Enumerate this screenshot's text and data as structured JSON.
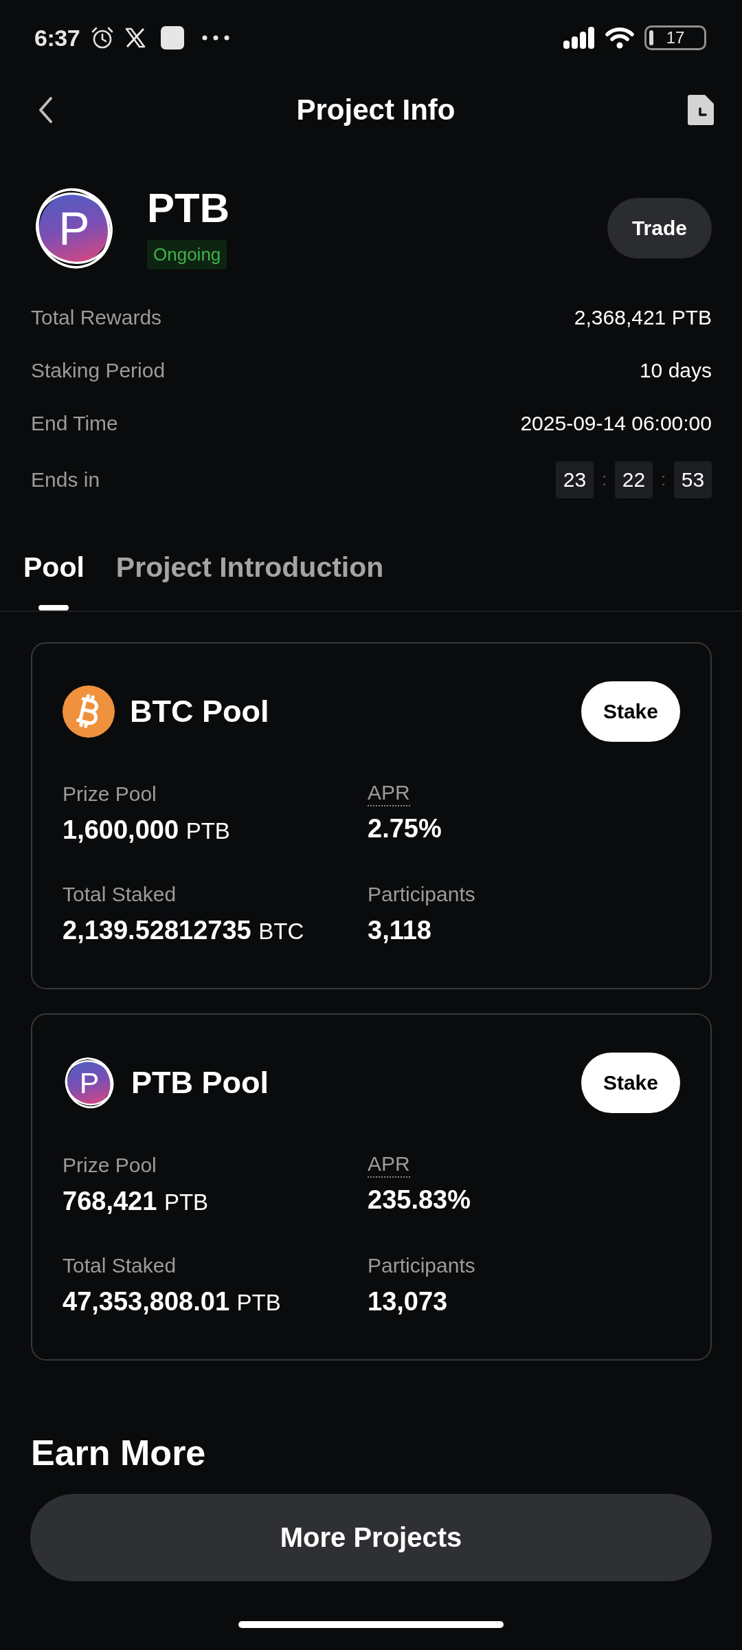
{
  "status_bar": {
    "time": "6:37",
    "battery": "17"
  },
  "header": {
    "title": "Project Info"
  },
  "project": {
    "logo_letter": "P",
    "name": "PTB",
    "status": "Ongoing",
    "trade_button": "Trade"
  },
  "details": [
    {
      "kind": "text",
      "label": "Total Rewards",
      "value": "2,368,421 PTB"
    },
    {
      "kind": "text",
      "label": "Staking Period",
      "value": "10 days"
    },
    {
      "kind": "text",
      "label": "End Time",
      "value": "2025-09-14 06:00:00"
    },
    {
      "kind": "countdown",
      "label": "Ends in",
      "parts": [
        {
          "kind": "digits",
          "text": "23"
        },
        {
          "kind": "separator",
          "text": ":"
        },
        {
          "kind": "digits",
          "text": "22"
        },
        {
          "kind": "separator",
          "text": ":"
        },
        {
          "kind": "digits",
          "text": "53"
        }
      ]
    }
  ],
  "tabs": [
    {
      "label": "Pool",
      "selected": true
    },
    {
      "label": "Project Introduction",
      "selected": false
    }
  ],
  "pools": [
    {
      "kind": "bitcoin",
      "name": "BTC Pool",
      "stake_button": "Stake",
      "stats": [
        {
          "label": "Prize Pool",
          "dotted_underline": false,
          "value": "1,600,000",
          "unit": "PTB"
        },
        {
          "label": "APR",
          "dotted_underline": true,
          "value": "2.75%"
        },
        {
          "label": "Total Staked",
          "dotted_underline": false,
          "value": "2,139.52812735",
          "unit": "BTC"
        },
        {
          "label": "Participants",
          "dotted_underline": false,
          "value": "3,118"
        }
      ]
    },
    {
      "kind": "token",
      "logo_letter": "P",
      "name": "PTB Pool",
      "stake_button": "Stake",
      "stats": [
        {
          "label": "Prize Pool",
          "dotted_underline": false,
          "value": "768,421",
          "unit": "PTB"
        },
        {
          "label": "APR",
          "dotted_underline": true,
          "value": "235.83%"
        },
        {
          "label": "Total Staked",
          "dotted_underline": false,
          "value": "47,353,808.01",
          "unit": "PTB"
        },
        {
          "label": "Participants",
          "dotted_underline": false,
          "value": "13,073"
        }
      ]
    }
  ],
  "earn_more": {
    "title": "Earn More",
    "button": "More Projects"
  }
}
